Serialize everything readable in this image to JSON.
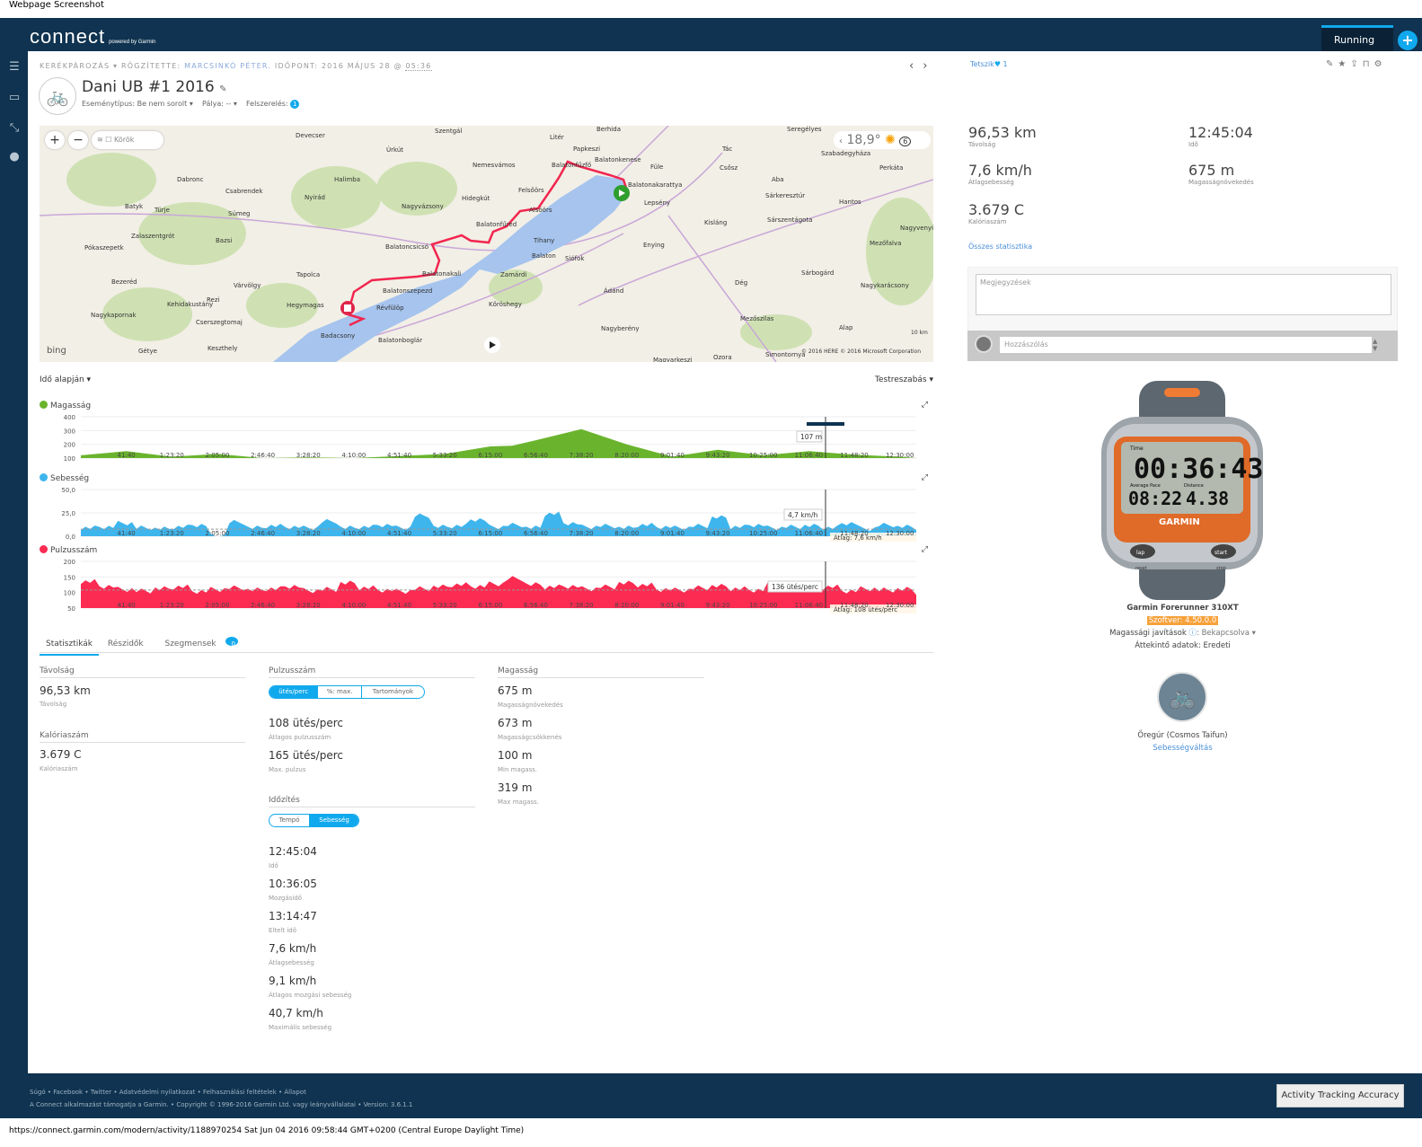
{
  "screenshot_title": "Webpage Screenshot",
  "header": {
    "logo": "connect",
    "logo_sub": "powered by Garmin",
    "activity_tab": "Running",
    "plus": "+"
  },
  "breadcrumb": {
    "type": "Kerékpározás",
    "recorded_by_label": "Rögzítette:",
    "author": "Marcsinkó Péter.",
    "time_label": "Időpont: 2016 május 28 @",
    "time": "05:36"
  },
  "activity": {
    "title": "Dani UB #1 2016",
    "event_type": "Eseménytípus: Be nem sorolt ▾",
    "course": "Pálya: -- ▾",
    "gear_label": "Felszerelés:",
    "gear_count": "1"
  },
  "map": {
    "laps_label": "Körök",
    "temperature": "18,9°",
    "wind": "6",
    "attribution": "© 2016 HERE   © 2016 Microsoft Corporation",
    "scale": "10 km",
    "brand": "bing",
    "places": [
      "Szentgál",
      "Berhida",
      "Devecser",
      "Litér",
      "Papkeszi",
      "Úrkút",
      "Nemesvámos",
      "Balatonfűzfő",
      "Füle",
      "Tác",
      "Csősz",
      "Perkáta",
      "Seregélyes",
      "Szabadegyháza",
      "Dabronc",
      "Csabrendek",
      "Halimba",
      "Hidegkút",
      "Felsőörs",
      "Alsóörs",
      "Balatonkenese",
      "Balatonfűred",
      "Balatonakarattya",
      "Lepsény",
      "Kisláng",
      "Aba",
      "Sárkeresztúr",
      "Hantos",
      "Batyk",
      "Türje",
      "Sümeg",
      "Nyirád",
      "Nagyvázsony",
      "Sárszentágota",
      "Nagyvenyim",
      "Zalaszentgrót",
      "Pókaszepetk",
      "Bazsi",
      "Tihany",
      "Siófok",
      "Enying",
      "Mezőfalva",
      "Balatoncsicsó",
      "Tapolca",
      "Zamárdi",
      "Bezeréd",
      "Várvölgy",
      "Balatonszepezd",
      "Balatonakali",
      "Sárbogárd",
      "Nagykarácsony",
      "Kehidakustány",
      "Rezi",
      "Hegymagas",
      "Révfülöp",
      "Kőröshegy",
      "Ádánd",
      "Dég",
      "Nagykapornak",
      "Cserszegtomaj",
      "Badacsony",
      "Balatonboglár",
      "Mezőszilas",
      "Keszthely",
      "Gétye",
      "Nagyberény",
      "Ozora",
      "Simontornya",
      "Magyarkeszi",
      "Alap",
      "Balaton"
    ]
  },
  "charts": {
    "mode": "Idő alapján ▾",
    "customize": "Testreszabás ▾",
    "expand": "⤢"
  },
  "chart_data": [
    {
      "type": "area",
      "name": "Magasság",
      "color": "#6ab42d",
      "x_unit": "s",
      "xlim": [
        0,
        45904
      ],
      "ylim": [
        100,
        400
      ],
      "yticks": [
        "100",
        "200",
        "300",
        "400"
      ],
      "xticks": [
        "41:40",
        "1:23:20",
        "2:05:00",
        "2:46:40",
        "3:28:20",
        "4:10:00",
        "4:51:40",
        "5:33:20",
        "6:15:00",
        "6:56:40",
        "7:38:20",
        "8:20:00",
        "9:01:40",
        "9:43:20",
        "10:25:00",
        "11:06:40",
        "11:48:20",
        "12:30:00"
      ],
      "x": [
        0,
        2500,
        5000,
        7500,
        10000,
        12500,
        15000,
        17500,
        20000,
        22500,
        23700,
        25000,
        27500,
        30000,
        32500,
        35000,
        37500,
        40000,
        42500,
        45000,
        45904
      ],
      "values": [
        120,
        150,
        110,
        130,
        100,
        105,
        100,
        115,
        130,
        185,
        190,
        230,
        310,
        200,
        110,
        160,
        120,
        150,
        125,
        110,
        100
      ],
      "tooltip": "107 m"
    },
    {
      "type": "area",
      "name": "Sebesség",
      "color": "#3eb5ec",
      "xlim": [
        0,
        45904
      ],
      "ylim": [
        0,
        50
      ],
      "yticks": [
        "0,0",
        "25,0",
        "50,0"
      ],
      "values": [
        9,
        10,
        14,
        9,
        8,
        10,
        12,
        0,
        15,
        9,
        11,
        10,
        9,
        16,
        9,
        10,
        12,
        9,
        22,
        10,
        11,
        18,
        10,
        12,
        9,
        24,
        14,
        10,
        11,
        9,
        12,
        10,
        9,
        11,
        20,
        10,
        12,
        9,
        10,
        11,
        9,
        14,
        8,
        12,
        10,
        9
      ],
      "tooltip": "4,7 km/h",
      "average": 7.6,
      "average_label": "Átlag: 7,6 km/h"
    },
    {
      "type": "area",
      "name": "Pulzusszám",
      "color": "#fb2b52",
      "xlim": [
        0,
        45904
      ],
      "ylim": [
        50,
        200
      ],
      "yticks": [
        "50",
        "100",
        "150",
        "200"
      ],
      "values": [
        135,
        120,
        110,
        105,
        112,
        118,
        104,
        110,
        115,
        108,
        112,
        120,
        106,
        110,
        130,
        115,
        108,
        104,
        112,
        118,
        125,
        120,
        128,
        145,
        125,
        118,
        120,
        112,
        118,
        130,
        124,
        110,
        108,
        115,
        120,
        112,
        108,
        125,
        120,
        110,
        118,
        105,
        112,
        108,
        110,
        100
      ],
      "tooltip": "136 ütés/perc",
      "average": 108,
      "average_label": "Átlag: 108 ütés/perc"
    }
  ],
  "tabs": [
    {
      "label": "Statisztikák"
    },
    {
      "label": "Részidők"
    },
    {
      "label": "Szegmensek",
      "badge": "0"
    }
  ],
  "stats": {
    "distance": {
      "title": "Távolság",
      "value": "96,53 km",
      "label": "Távolság"
    },
    "calories": {
      "title": "Kalóriaszám",
      "value": "3.679 C",
      "label": "Kalóriaszám"
    },
    "hr": {
      "title": "Pulzusszám",
      "toggle": [
        "ütés/perc",
        "%: max.",
        "Tartományok"
      ],
      "items": [
        {
          "value": "108 ütés/perc",
          "label": "Átlagos pulzusszám"
        },
        {
          "value": "165 ütés/perc",
          "label": "Max. pulzus"
        }
      ]
    },
    "timing": {
      "title": "Időzítés",
      "toggle": [
        "Tempó",
        "Sebesség"
      ],
      "items": [
        {
          "value": "12:45:04",
          "label": "Idő"
        },
        {
          "value": "10:36:05",
          "label": "Mozgásidő"
        },
        {
          "value": "13:14:47",
          "label": "Eltelt idő"
        },
        {
          "value": "7,6 km/h",
          "label": "Átlagsebesség"
        },
        {
          "value": "9,1 km/h",
          "label": "Átlagos mozgási sebesség"
        },
        {
          "value": "40,7 km/h",
          "label": "Maximális sebesség"
        }
      ]
    },
    "elevation": {
      "title": "Magasság",
      "items": [
        {
          "value": "675 m",
          "label": "Magasságnövekedés"
        },
        {
          "value": "673 m",
          "label": "Magasságcsökkenés"
        },
        {
          "value": "100 m",
          "label": "Min magass."
        },
        {
          "value": "319 m",
          "label": "Max magass."
        }
      ]
    }
  },
  "summary": {
    "like": "Tetszik",
    "like_count": "1",
    "items": [
      {
        "value": "96,53 km",
        "label": "Távolság"
      },
      {
        "value": "12:45:04",
        "label": "Idő"
      },
      {
        "value": "7,6 km/h",
        "label": "Átlagsebesség"
      },
      {
        "value": "675 m",
        "label": "Magasságnövekedés"
      },
      {
        "value": "3.679 C",
        "label": "Kalóriaszám"
      }
    ],
    "all_stats": "Összes statisztika",
    "notes_placeholder": "Megjegyzések",
    "comment_placeholder": "Hozzászólás"
  },
  "device": {
    "name": "Garmin Forerunner 310XT",
    "software": "Szoftver: 4.50.0.0",
    "elev_corr": "Magassági javítások",
    "elev_corr_value": ": Bekapcsolva ▾",
    "summary_data": "Áttekintő adatok: Eredeti",
    "watch": {
      "time": "00:36:43",
      "pace": "08:22",
      "distance": "4.38",
      "brand": "GARMIN",
      "btn_lap": "lap",
      "btn_start": "start",
      "btn_reset": "reset",
      "btn_stop": "stop",
      "l_time": "Time",
      "l_pace": "Average Pace",
      "l_dist": "Distance"
    }
  },
  "gear": {
    "name": "Öregúr (Cosmos Taifun)",
    "action": "Sebességváltás"
  },
  "footer": {
    "links": [
      "Súgó",
      "Facebook",
      "Twitter",
      "Adatvédelmi nyilatkozat",
      "Felhasználási feltételek",
      "Állapot"
    ],
    "copyright": "A Connect alkalmazást támogatja a Garmin. • Copyright © 1996-2016 Garmin Ltd. vagy leányvállalatai • Version: 3.6.1.1"
  },
  "activity_tracking_button": "Activity Tracking Accuracy",
  "status_url": "https://connect.garmin.com/modern/activity/1188970254 Sat Jun 04 2016 09:58:44 GMT+0200 (Central Europe Daylight Time)"
}
